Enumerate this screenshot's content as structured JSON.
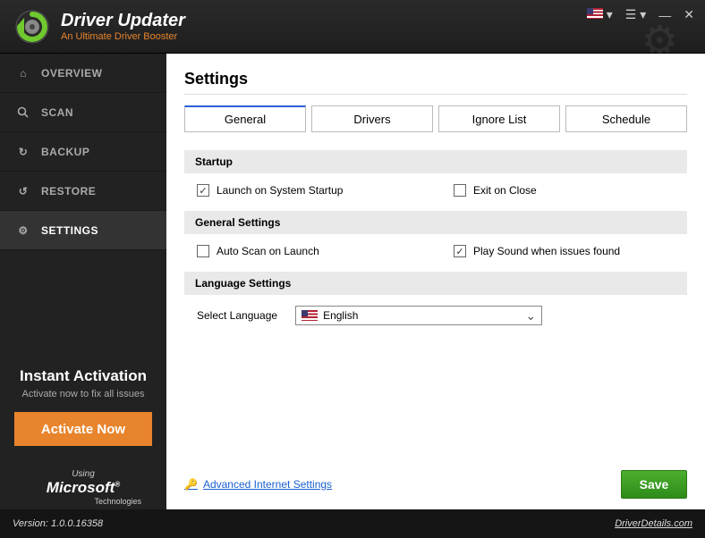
{
  "header": {
    "title": "Driver Updater",
    "subtitle": "An Ultimate Driver Booster"
  },
  "sidebar": {
    "items": [
      {
        "label": "OVERVIEW",
        "icon": "home"
      },
      {
        "label": "SCAN",
        "icon": "search"
      },
      {
        "label": "BACKUP",
        "icon": "refresh"
      },
      {
        "label": "RESTORE",
        "icon": "refresh"
      },
      {
        "label": "SETTINGS",
        "icon": "gear"
      }
    ],
    "promo": {
      "title": "Instant Activation",
      "subtitle": "Activate now to fix all issues",
      "button": "Activate Now"
    },
    "ms": {
      "using": "Using",
      "logo": "Microsoft",
      "tech": "Technologies"
    }
  },
  "page": {
    "title": "Settings",
    "tabs": [
      "General",
      "Drivers",
      "Ignore List",
      "Schedule"
    ],
    "active_tab": 0,
    "sections": {
      "startup": {
        "title": "Startup",
        "opt1": {
          "label": "Launch on System Startup",
          "checked": true
        },
        "opt2": {
          "label": "Exit on Close",
          "checked": false
        }
      },
      "general": {
        "title": "General Settings",
        "opt1": {
          "label": "Auto Scan on Launch",
          "checked": false
        },
        "opt2": {
          "label": "Play Sound when issues found",
          "checked": true
        }
      },
      "language": {
        "title": "Language Settings",
        "label": "Select Language",
        "value": "English"
      }
    },
    "advanced_link": "Advanced Internet Settings",
    "save": "Save"
  },
  "footer": {
    "version_label": "Version: 1.0.0.16358",
    "site": "DriverDetails.com"
  }
}
